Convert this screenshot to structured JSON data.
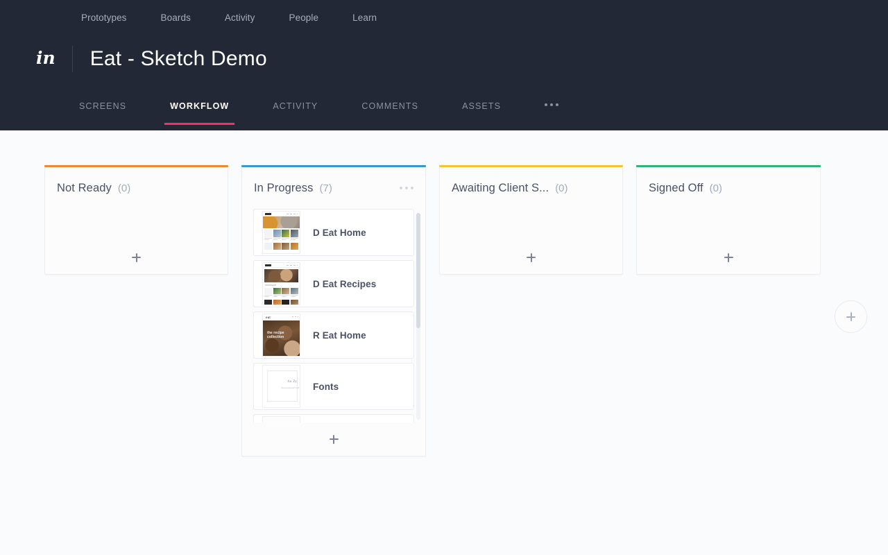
{
  "header": {
    "logo": "in",
    "logo_icon": "invision-logo-icon",
    "project_title": "Eat - Sketch Demo",
    "global_nav": [
      {
        "label": "Prototypes"
      },
      {
        "label": "Boards"
      },
      {
        "label": "Activity"
      },
      {
        "label": "People"
      },
      {
        "label": "Learn"
      }
    ],
    "tabs": [
      {
        "label": "SCREENS",
        "active": false
      },
      {
        "label": "WORKFLOW",
        "active": true
      },
      {
        "label": "ACTIVITY",
        "active": false
      },
      {
        "label": "COMMENTS",
        "active": false
      },
      {
        "label": "ASSETS",
        "active": false
      }
    ],
    "more_tabs_icon": "ellipsis-icon",
    "accent_color": "#ff2d62",
    "background_color": "#232836"
  },
  "board": {
    "add_column_label": "+",
    "add_card_label": "+",
    "columns": [
      {
        "name": "Not Ready",
        "count": "(0)",
        "accent": "#f2892e",
        "cards": []
      },
      {
        "name": "In Progress",
        "count": "(7)",
        "accent": "#3699d3",
        "menu_icon": "ellipsis-icon",
        "cards": [
          {
            "title": "D Eat Home",
            "thumb": "desktop-eat-home-thumbnail"
          },
          {
            "title": "D Eat Recipes",
            "thumb": "desktop-eat-recipes-thumbnail"
          },
          {
            "title": "R Eat Home",
            "thumb": "responsive-eat-home-thumbnail"
          },
          {
            "title": "Fonts",
            "thumb": "fonts-specimen-thumbnail"
          },
          {
            "title": "",
            "thumb": "partial-card-thumbnail"
          }
        ]
      },
      {
        "name": "Awaiting Client S...",
        "count": "(0)",
        "accent": "#f5c430",
        "cards": []
      },
      {
        "name": "Signed Off",
        "count": "(0)",
        "accent": "#2bb673",
        "cards": []
      }
    ]
  },
  "thumbnails": {
    "eat_logo": "eat",
    "recipe_overlay_line1": "the recipe",
    "recipe_overlay_line2": "collection",
    "fonts_sample": "Aa Zz",
    "fonts_name": "SourceSansPro-R"
  }
}
